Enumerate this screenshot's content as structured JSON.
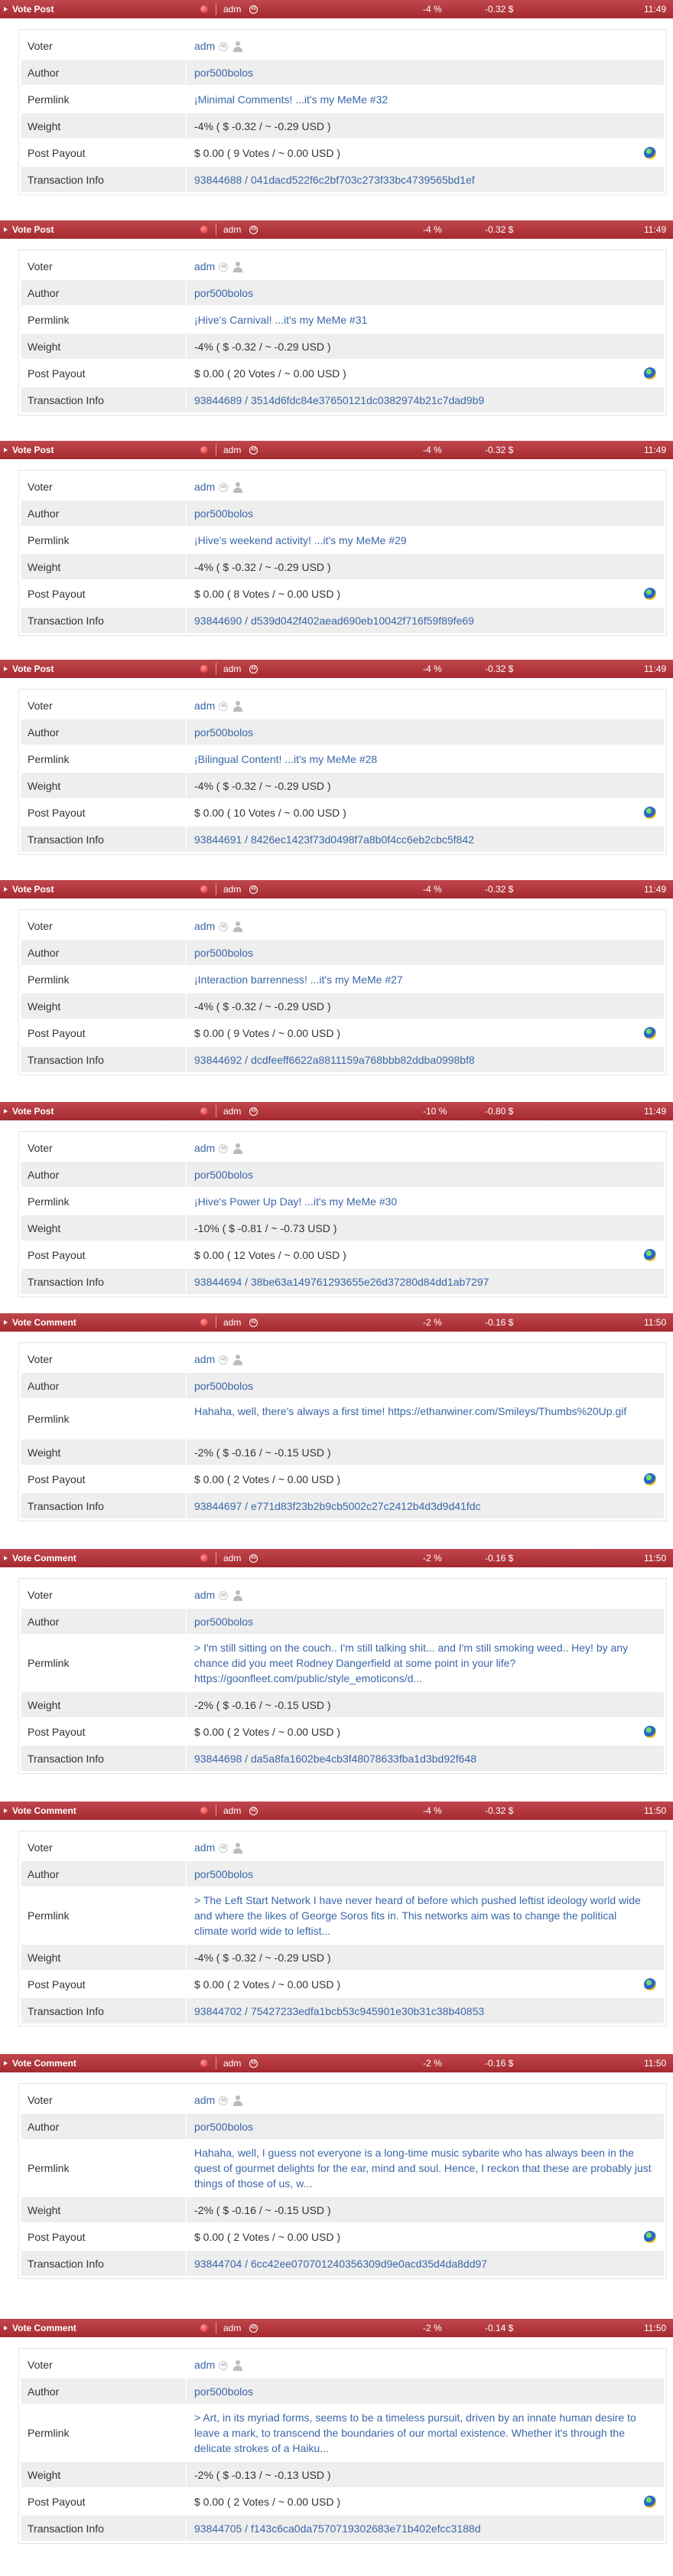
{
  "labels": {
    "voter": "Voter",
    "author": "Author",
    "permlink": "Permlink",
    "weight": "Weight",
    "post_payout": "Post Payout",
    "transaction_info": "Transaction Info"
  },
  "colors": {
    "header_red": "#b83a40",
    "link_blue": "#3a67a8",
    "row_alt": "#eeeeee"
  },
  "icons": [
    "expand-arrow-icon",
    "vote-dot-icon",
    "reputation-badge-icon",
    "user-icon",
    "globe-icon"
  ],
  "entries": [
    {
      "op": "Vote Post",
      "voter": "adm",
      "badge": "48",
      "pct": "-4 %",
      "usd": "-0.32 $",
      "time": "11:49",
      "author": "por500bolos",
      "permlink": "¡Minimal Comments! ...it's my MeMe #32",
      "weight": "-4% ( $ -0.32 / ~ -0.29 USD )",
      "payout": "$ 0.00 ( 9 Votes / ~ 0.00 USD )",
      "txid": "93844688",
      "txhash": "041dacd522f6c2bf703c273f33bc4739565bd1ef"
    },
    {
      "op": "Vote Post",
      "voter": "adm",
      "badge": "48",
      "pct": "-4 %",
      "usd": "-0.32 $",
      "time": "11:49",
      "author": "por500bolos",
      "permlink": "¡Hive's Carnival! ...it's my MeMe #31",
      "weight": "-4% ( $ -0.32 / ~ -0.29 USD )",
      "payout": "$ 0.00 ( 20 Votes / ~ 0.00 USD )",
      "txid": "93844689",
      "txhash": "3514d6fdc84e37650121dc0382974b21c7dad9b9"
    },
    {
      "op": "Vote Post",
      "voter": "adm",
      "badge": "48",
      "pct": "-4 %",
      "usd": "-0.32 $",
      "time": "11:49",
      "author": "por500bolos",
      "permlink": "¡Hive's weekend activity! ...it's my MeMe #29",
      "weight": "-4% ( $ -0.32 / ~ -0.29 USD )",
      "payout": "$ 0.00 ( 8 Votes / ~ 0.00 USD )",
      "txid": "93844690",
      "txhash": "d539d042f402aead690eb10042f716f59f89fe69"
    },
    {
      "op": "Vote Post",
      "voter": "adm",
      "badge": "48",
      "pct": "-4 %",
      "usd": "-0.32 $",
      "time": "11:49",
      "author": "por500bolos",
      "permlink": "¡Bilingual Content! ...it's my MeMe #28",
      "weight": "-4% ( $ -0.32 / ~ -0.29 USD )",
      "payout": "$ 0.00 ( 10 Votes / ~ 0.00 USD )",
      "txid": "93844691",
      "txhash": "8426ec1423f73d0498f7a8b0f4cc6eb2cbc5f842"
    },
    {
      "op": "Vote Post",
      "voter": "adm",
      "badge": "48",
      "pct": "-4 %",
      "usd": "-0.32 $",
      "time": "11:49",
      "author": "por500bolos",
      "permlink": "¡Interaction barrenness! ...it's my MeMe #27",
      "weight": "-4% ( $ -0.32 / ~ -0.29 USD )",
      "payout": "$ 0.00 ( 9 Votes / ~ 0.00 USD )",
      "txid": "93844692",
      "txhash": "dcdfeeff6622a8811159a768bbb82ddba0998bf8"
    },
    {
      "op": "Vote Post",
      "voter": "adm",
      "badge": "48",
      "pct": "-10 %",
      "usd": "-0.80 $",
      "time": "11:49",
      "author": "por500bolos",
      "permlink": "¡Hive's Power Up Day! ...it's my MeMe #30",
      "weight": "-10% ( $ -0.81 / ~ -0.73 USD )",
      "payout": "$ 0.00 ( 12 Votes / ~ 0.00 USD )",
      "txid": "93844694",
      "txhash": "38be63a149761293655e26d37280d84dd1ab7297"
    },
    {
      "op": "Vote Comment",
      "voter": "adm",
      "badge": "48",
      "pct": "-2 %",
      "usd": "-0.16 $",
      "time": "11:50",
      "author": "por500bolos",
      "permlink": "Hahaha, well, there's always a first time! https://ethanwiner.com/Smileys/Thumbs%20Up.gif",
      "weight": "-2% ( $ -0.16 / ~ -0.15 USD )",
      "payout": "$ 0.00 ( 2 Votes / ~ 0.00 USD )",
      "txid": "93844697",
      "txhash": "e771d83f23b2b9cb5002c27c2412b4d3d9d41fdc"
    },
    {
      "op": "Vote Comment",
      "voter": "adm",
      "badge": "48",
      "pct": "-2 %",
      "usd": "-0.16 $",
      "time": "11:50",
      "author": "por500bolos",
      "permlink": "> I'm still sitting on the couch.. I'm still talking shit... and I'm still smoking weed.. Hey! by any chance did you meet Rodney Dangerfield at some point in your life? https://goonfleet.com/public/style_emoticons/d...",
      "weight": "-2% ( $ -0.16 / ~ -0.15 USD )",
      "payout": "$ 0.00 ( 2 Votes / ~ 0.00 USD )",
      "txid": "93844698",
      "txhash": "da5a8fa1602be4cb3f48078633fba1d3bd92f648"
    },
    {
      "op": "Vote Comment",
      "voter": "adm",
      "badge": "48",
      "pct": "-4 %",
      "usd": "-0.32 $",
      "time": "11:50",
      "author": "por500bolos",
      "permlink": "> The Left Start Network I have never heard of before which pushed leftist ideology world wide and where the likes of George Soros fits in. This networks aim was to change the political climate world wide to leftist...",
      "weight": "-4% ( $ -0.32 / ~ -0.29 USD )",
      "payout": "$ 0.00 ( 2 Votes / ~ 0.00 USD )",
      "txid": "93844702",
      "txhash": "75427233edfa1bcb53c945901e30b31c38b40853"
    },
    {
      "op": "Vote Comment",
      "voter": "adm",
      "badge": "48",
      "pct": "-2 %",
      "usd": "-0.16 $",
      "time": "11:50",
      "author": "por500bolos",
      "permlink": "Hahaha, well, I guess not everyone is a long-time music sybarite who has always been in the quest of gourmet delights for the ear, mind and soul. Hence, I reckon that these are probably just things of those of us, w...",
      "weight": "-2% ( $ -0.16 / ~ -0.15 USD )",
      "payout": "$ 0.00 ( 2 Votes / ~ 0.00 USD )",
      "txid": "93844704",
      "txhash": "6cc42ee070701240356309d9e0acd35d4da8dd97"
    },
    {
      "op": "Vote Comment",
      "voter": "adm",
      "badge": "48",
      "pct": "-2 %",
      "usd": "-0.14 $",
      "time": "11:50",
      "author": "por500bolos",
      "permlink": "> Art, in its myriad forms, seems to be a timeless pursuit, driven by an innate human desire to leave a mark, to transcend the boundaries of our mortal existence. Whether it's through the delicate strokes of a Haiku...",
      "weight": "-2% ( $ -0.13 / ~ -0.13 USD )",
      "payout": "$ 0.00 ( 2 Votes / ~ 0.00 USD )",
      "txid": "93844705",
      "txhash": "f143c6ca0da7570719302683e71b402efcc3188d"
    }
  ]
}
